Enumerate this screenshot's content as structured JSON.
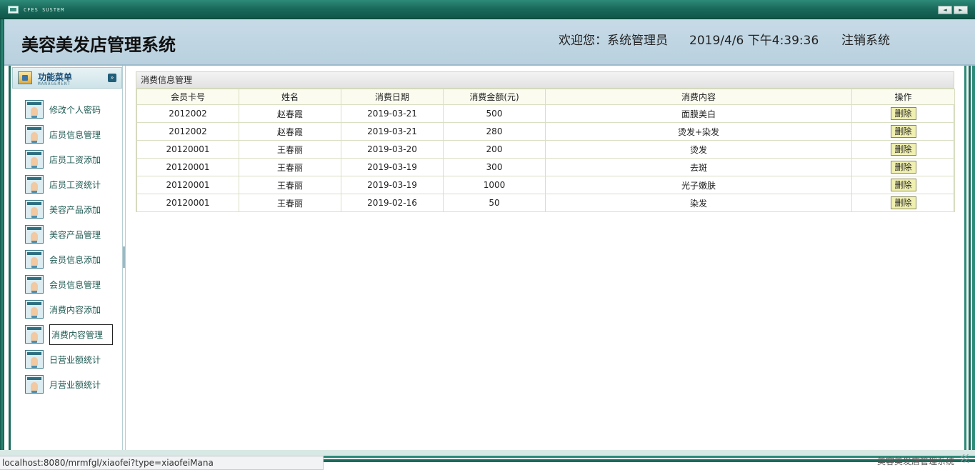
{
  "top_strip": {
    "system_label": "CFES SUSTEM",
    "nav_prev": "◄",
    "nav_next": "►"
  },
  "header": {
    "app_title": "美容美发店管理系统",
    "welcome": "欢迎您：系统管理员",
    "datetime": "2019/4/6 下午4:39:36",
    "logout": "注销系统"
  },
  "sidebar": {
    "menu_title": "功能菜单",
    "menu_subtitle": "MANAGEMENT",
    "collapse_glyph": "»",
    "items": [
      {
        "label": "修改个人密码"
      },
      {
        "label": "店员信息管理"
      },
      {
        "label": "店员工资添加"
      },
      {
        "label": "店员工资统计"
      },
      {
        "label": "美容产品添加"
      },
      {
        "label": "美容产品管理"
      },
      {
        "label": "会员信息添加"
      },
      {
        "label": "会员信息管理"
      },
      {
        "label": "消费内容添加"
      },
      {
        "label": "消费内容管理",
        "active": true
      },
      {
        "label": "日营业额统计"
      },
      {
        "label": "月营业额统计"
      }
    ]
  },
  "main": {
    "panel_title": "消费信息管理",
    "columns": [
      "会员卡号",
      "姓名",
      "消费日期",
      "消费金额(元)",
      "消费内容",
      "操作"
    ],
    "delete_label": "删除",
    "rows": [
      {
        "card": "2012002",
        "name": "赵春霞",
        "date": "2019-03-21",
        "amount": "500",
        "content": "面膜美白"
      },
      {
        "card": "2012002",
        "name": "赵春霞",
        "date": "2019-03-21",
        "amount": "280",
        "content": "烫发+染发"
      },
      {
        "card": "20120001",
        "name": "王春丽",
        "date": "2019-03-20",
        "amount": "200",
        "content": "烫发"
      },
      {
        "card": "20120001",
        "name": "王春丽",
        "date": "2019-03-19",
        "amount": "300",
        "content": "去斑"
      },
      {
        "card": "20120001",
        "name": "王春丽",
        "date": "2019-03-19",
        "amount": "1000",
        "content": "光子嫩肤"
      },
      {
        "card": "20120001",
        "name": "王春丽",
        "date": "2019-02-16",
        "amount": "50",
        "content": "染发"
      }
    ]
  },
  "footer": {
    "text": "美容美发店管理系统"
  },
  "status_bar": {
    "url": "localhost:8080/mrmfgl/xiaofei?type=xiaofeiMana"
  },
  "colors": {
    "frame_green": "#1a6b5c",
    "header_blue": "#c7dbe7",
    "menu_text": "#1f5a52",
    "delete_button_bg": "#f0f0b0"
  }
}
